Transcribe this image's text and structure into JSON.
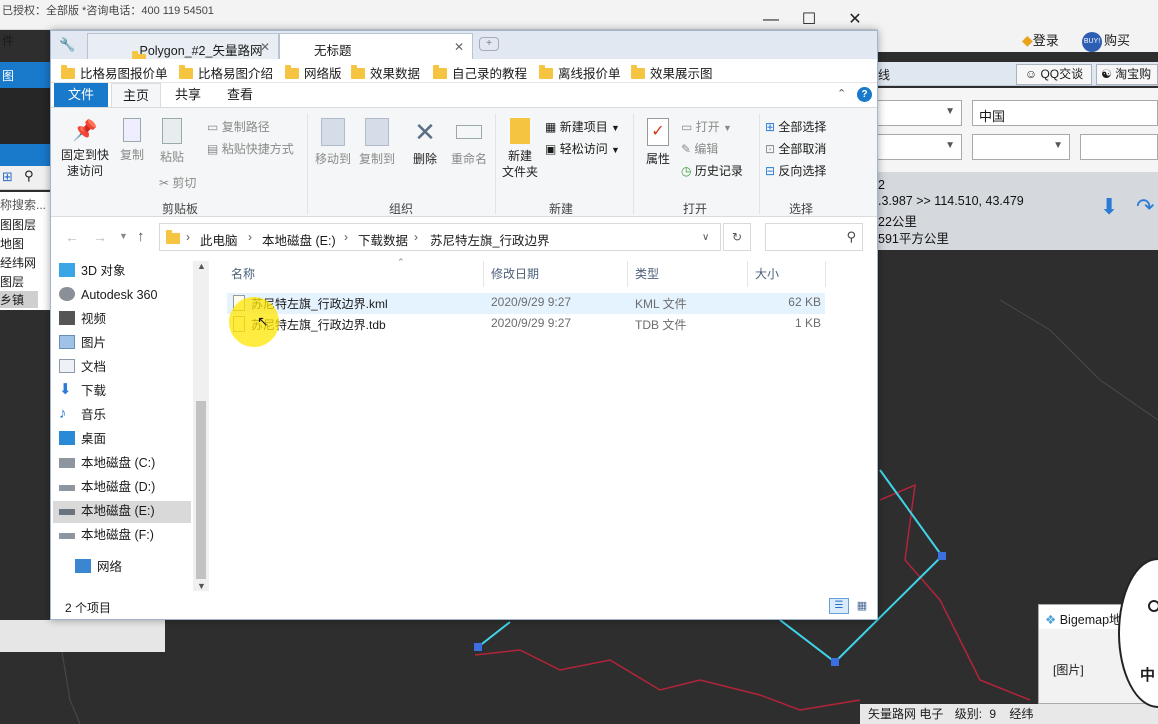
{
  "background_app": {
    "license_text": "已授权：全部版 *咨询电话：400 119 54501",
    "menu_label": "件",
    "tab_label": "图",
    "login": "登录",
    "buy_badge": "BUY!",
    "buy": "购买",
    "toolbar_fragment": "线",
    "qq_chat": "QQ交谈",
    "taobao": "淘宝购",
    "region_select": "中国",
    "info": {
      "line1": "2",
      "line2": ".3.987 >> 114.510, 43.479",
      "line3": "22公里",
      "line4": "591平方公里"
    },
    "left_search": "称搜索...",
    "left_items": [
      "图图层",
      "地图",
      "经纬网",
      "图层",
      "乡镇"
    ],
    "status": {
      "map": "矢量路网 电子",
      "level_label": "级别:",
      "level": "9",
      "extra": "经纬"
    },
    "popup": {
      "title": "Bigemap地",
      "body": "[图片]",
      "badge": "中"
    }
  },
  "explorer": {
    "tabs": [
      {
        "label": "Polygon_#2_矢量路网",
        "active": false
      },
      {
        "label": "无标题",
        "active": true
      }
    ],
    "bookmarks": [
      "比格易图报价单",
      "比格易图介绍",
      "网络版",
      "效果数据",
      "自己录的教程",
      "离线报价单",
      "效果展示图"
    ],
    "ribbon_tabs": [
      "文件",
      "主页",
      "共享",
      "查看"
    ],
    "ribbon": {
      "clipboard": {
        "pin": "固定到快\n速访问",
        "copy": "复制",
        "paste": "粘贴",
        "copy_path": "复制路径",
        "paste_shortcut": "粘贴快捷方式",
        "cut": "剪切",
        "group": "剪贴板"
      },
      "organize": {
        "move_to": "移动到",
        "copy_to": "复制到",
        "delete": "删除",
        "rename": "重命名",
        "group": "组织"
      },
      "new": {
        "new_folder": "新建\n文件夹",
        "new_item": "新建项目",
        "easy_access": "轻松访问",
        "group": "新建"
      },
      "open": {
        "properties": "属性",
        "open": "打开",
        "edit": "编辑",
        "history": "历史记录",
        "group": "打开"
      },
      "select": {
        "select_all": "全部选择",
        "select_none": "全部取消",
        "invert": "反向选择",
        "group": "选择"
      }
    },
    "breadcrumb": [
      "此电脑",
      "本地磁盘 (E:)",
      "下载数据",
      "苏尼特左旗_行政边界"
    ],
    "nav_items": [
      "3D 对象",
      "Autodesk 360",
      "视频",
      "图片",
      "文档",
      "下载",
      "音乐",
      "桌面",
      "本地磁盘 (C:)",
      "本地磁盘 (D:)",
      "本地磁盘 (E:)",
      "本地磁盘 (F:)",
      "网络"
    ],
    "columns": [
      "名称",
      "修改日期",
      "类型",
      "大小"
    ],
    "files": [
      {
        "name": "苏尼特左旗_行政边界.kml",
        "date": "2020/9/29 9:27",
        "type": "KML 文件",
        "size": "62 KB"
      },
      {
        "name": "苏尼特左旗_行政边界.tdb",
        "date": "2020/9/29 9:27",
        "type": "TDB 文件",
        "size": "1 KB"
      }
    ],
    "status": "2 个项目"
  },
  "colors": {
    "accent": "#1979ca",
    "map_bg": "#2e2e2e",
    "boundary": "#b3243a",
    "selection_line": "#3fd4e8"
  }
}
